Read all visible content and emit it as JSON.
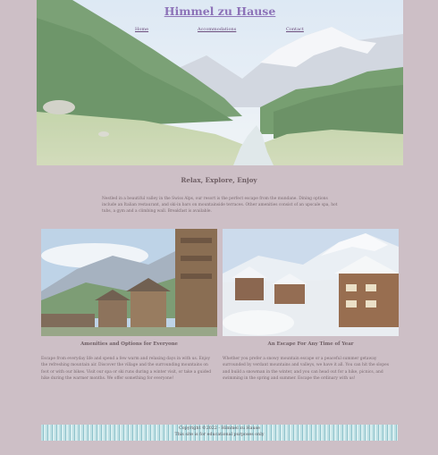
{
  "site": {
    "title": "Himmel zu Hause"
  },
  "nav": {
    "items": [
      {
        "label": "Home"
      },
      {
        "label": "Accommodations"
      },
      {
        "label": "Contact"
      }
    ]
  },
  "intro": {
    "heading": "Relax, Explore, Enjoy",
    "text": "Nestled in a beautiful valley in the Swiss Alps, our resort is the perfect escape from the mundane. Dining options include an Italian restaurant, and ski-in bars on mountainside terraces. Other amenities consist of an upscale spa, hot tubs, a gym and a climbing wall. Breakfast is available."
  },
  "cards": [
    {
      "heading": "Amenities and Options for Everyone",
      "text": "Escape from everyday life and spend a few warm and relaxing days in with us. Enjoy the refreshing mountain air. Discover the village and the surrounding mountains on foot or with our bikes. Visit our spa or ski runs during a winter visit, or take a guided hike during the warmer months. We offer something for everyone!"
    },
    {
      "heading": "An Escape For Any Time of Year",
      "text": "Whether you prefer a snowy mountain escape or a peaceful summer getaway surrounded by verdant mountains and valleys, we have it all. You can hit the slopes and build a snowman in the winter, and you can head out for a hike, picnics, and swimming in the spring and summer. Escape the ordinary with us!"
    }
  ],
  "footer": {
    "line1": "Copyright ©2022 - Himmel zu Hause",
    "line2": "This site is for educational purposes only"
  }
}
